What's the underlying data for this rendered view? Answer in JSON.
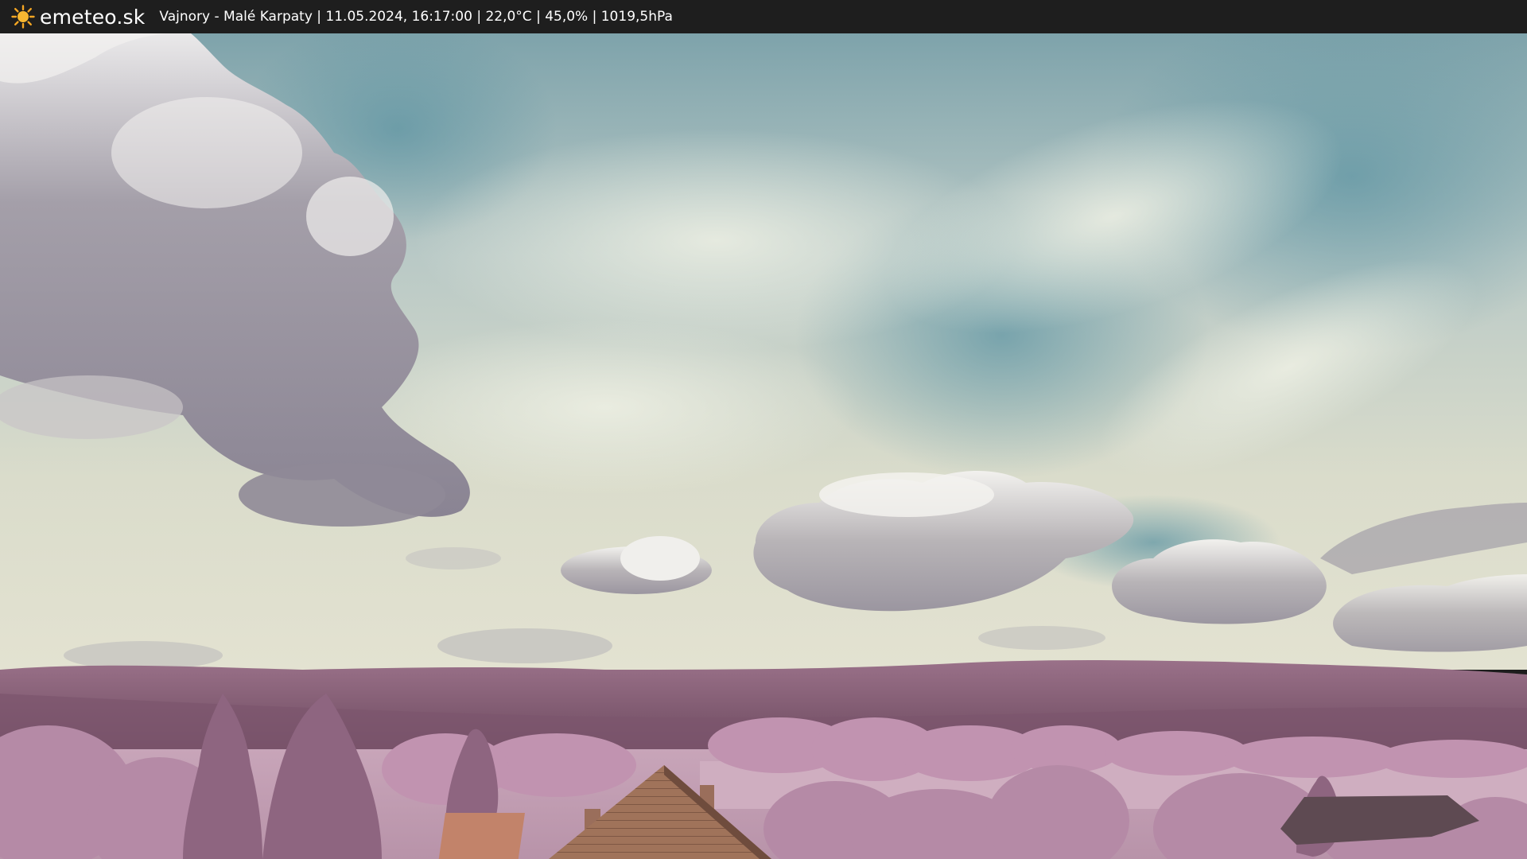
{
  "header": {
    "brand": "emeteo.sk",
    "caption": "Vajnory - Malé Karpaty | 11.05.2024, 16:17:00 | 22,0°C | 45,0% | 1019,5hPa",
    "logo_icon": "sun-icon"
  },
  "colors": {
    "bar": "#1e1e1e",
    "sun": "#f5a623",
    "sky_top": "#6f9aa4",
    "sky_haze": "#dfe2d2",
    "hills": "#8a5f78",
    "foliage": "#b98aa8",
    "roof": "#a0735a"
  },
  "camera_view": {
    "description_icon": "webcam-image"
  }
}
